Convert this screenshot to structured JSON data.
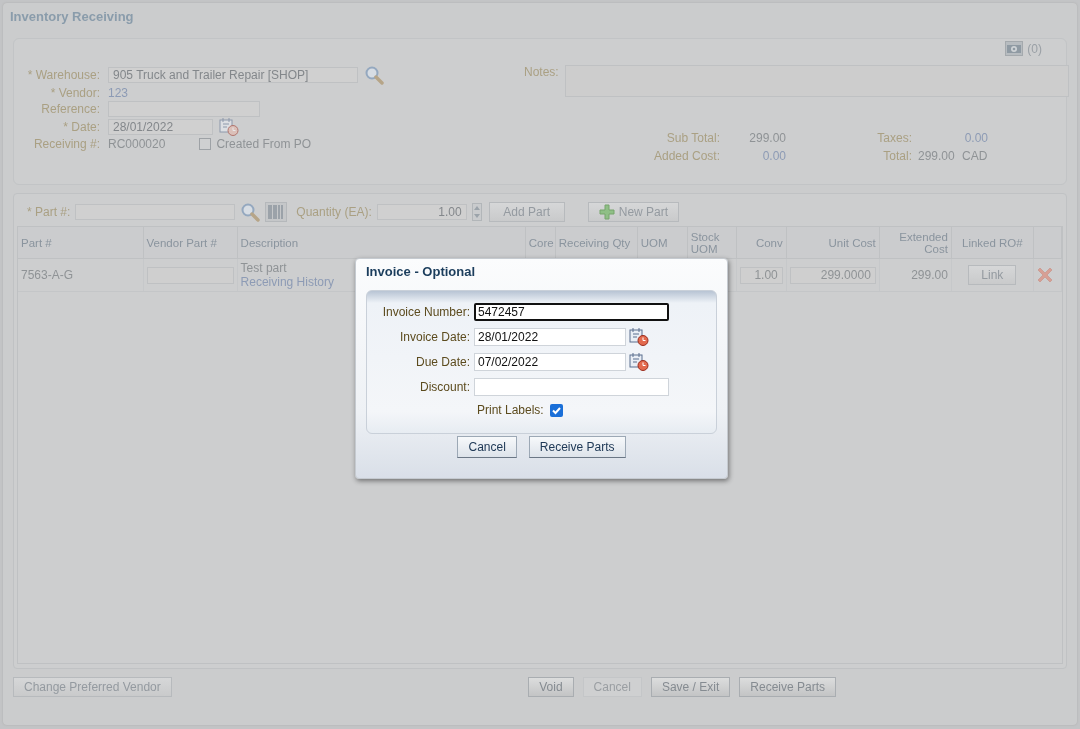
{
  "page": {
    "title": "Inventory Receiving",
    "attachments_count": "(0)"
  },
  "header_form": {
    "fields": [
      {
        "label": "* Warehouse:",
        "kind": "lookup",
        "value": "905 Truck and Trailer Repair [SHOP]"
      },
      {
        "label": "* Vendor:",
        "kind": "link",
        "value": "123"
      },
      {
        "label": "Reference:",
        "kind": "input"
      },
      {
        "label": "* Date:",
        "kind": "date",
        "value": "28/01/2022"
      },
      {
        "label": "Receiving #:",
        "kind": "text",
        "value": "RC000020"
      }
    ],
    "created_from_po": {
      "label": "Created From PO",
      "checked": false
    }
  },
  "notes": {
    "label": "Notes:"
  },
  "totals": [
    {
      "label": "Sub Total:",
      "kind": "plain",
      "value": "299.00"
    },
    {
      "label": "Taxes:",
      "kind": "link",
      "value": "0.00"
    },
    {
      "label": "Added Cost:",
      "kind": "link",
      "value": "0.00"
    },
    {
      "label": "Total:",
      "kind": "plain",
      "value": "299.00",
      "currency": "CAD"
    }
  ],
  "parts_toolbar": {
    "part_label": "* Part #:",
    "quantity_label": "Quantity (EA):",
    "quantity": "1.00",
    "add_button": "Add Part",
    "new_button": "New Part"
  },
  "table": {
    "columns": [
      "Part #",
      "Vendor Part #",
      "Description",
      "Core",
      "Receiving Qty",
      "UOM",
      "Stock UOM",
      "Conv",
      "Unit Cost",
      "Extended Cost",
      "Linked RO#"
    ],
    "rows": [
      {
        "part": "7563-A-G",
        "description": "Test part",
        "history_link": "Receiving History",
        "conv": "1.00",
        "unit_cost": "299.0000",
        "extended_cost": "299.00",
        "linked_ro": "Link"
      }
    ]
  },
  "footer": {
    "left_button": "Change Preferred Vendor",
    "buttons": [
      {
        "label": "Void",
        "disabled": false
      },
      {
        "label": "Cancel",
        "disabled": true
      },
      {
        "label": "Save / Exit",
        "disabled": false
      },
      {
        "label": "Receive Parts",
        "disabled": false
      }
    ]
  },
  "dialog": {
    "title": "Invoice - Optional",
    "fields": [
      {
        "label": "Invoice Number:",
        "kind": "text",
        "value": "5472457",
        "focused": true
      },
      {
        "label": "Invoice Date:",
        "kind": "date",
        "value": "28/01/2022",
        "focused": false
      },
      {
        "label": "Due Date:",
        "kind": "date",
        "value": "07/02/2022",
        "focused": false
      },
      {
        "label": "Discount:",
        "kind": "text",
        "focused": false
      }
    ],
    "print_labels": {
      "label": "Print Labels:",
      "checked": true
    },
    "buttons": [
      "Cancel",
      "Receive Parts"
    ]
  }
}
